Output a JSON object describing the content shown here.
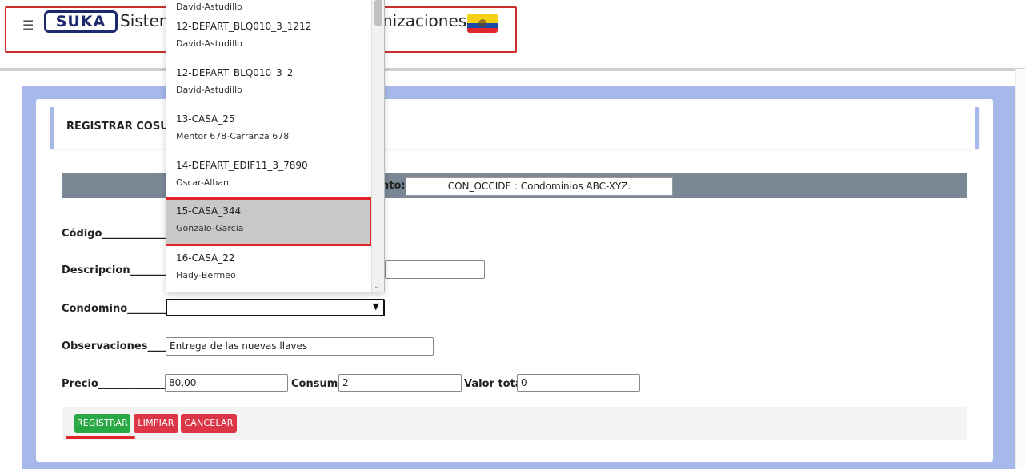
{
  "header": {
    "menu_icon": "hamburger-icon",
    "logo_text": "SUKA",
    "title_left": "Sister",
    "title_right": "nizaciones",
    "flag_icon": "ecuador-flag-icon"
  },
  "form": {
    "section_title": "REGISTRAR COSUM",
    "band_label": "nto:",
    "band_value": "CON_OCCIDE : Condominios ABC-XYZ.",
    "codigo_label": "Código______________",
    "descripcion_label": "Descripcion_________:",
    "condomino_label": "Condomino________:",
    "condomino_value": "",
    "observaciones_label": "Observaciones______:",
    "observaciones_value": "Entrega de las nuevas llaves",
    "precio_label": "Precio_____________:",
    "precio_value": "80,00",
    "consumo_label": "Consumo",
    "consumo_value": "2",
    "valor_total_label": "Valor total",
    "valor_total_value": "0"
  },
  "buttons": {
    "registrar": "REGISTRAR",
    "limpiar": "LIMPIAR",
    "cancelar": "CANCELAR"
  },
  "dropdown": {
    "items": [
      {
        "code": "",
        "name": "David-Astudillo"
      },
      {
        "code": "12-DEPART_BLQ010_3_1212",
        "name": "David-Astudillo"
      },
      {
        "code": "12-DEPART_BLQ010_3_2",
        "name": "David-Astudillo"
      },
      {
        "code": "13-CASA_25",
        "name": "Mentor 678-Carranza 678"
      },
      {
        "code": "14-DEPART_EDIF11_3_7890",
        "name": "Oscar-Alban"
      },
      {
        "code": "15-CASA_344",
        "name": "Gonzalo-Garcia"
      },
      {
        "code": "16-CASA_22",
        "name": "Hady-Bermeo"
      }
    ],
    "selected_index": 5
  },
  "colors": {
    "accent_red": "#e0262b",
    "frame_blue": "#a6b9ea",
    "band_gray": "#7a8896",
    "btn_green": "#28a745",
    "btn_red": "#dc3545"
  }
}
